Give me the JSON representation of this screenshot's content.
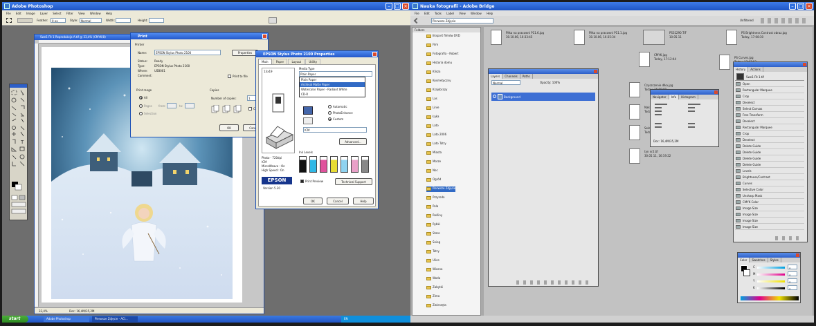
{
  "left": {
    "title": "Adobe Photoshop",
    "menus": [
      "File",
      "Edit",
      "Image",
      "Layer",
      "Select",
      "Filter",
      "View",
      "Window",
      "Help"
    ],
    "options": {
      "feather_label": "Feather:",
      "feather_value": "0 px",
      "style_label": "Style:",
      "style_value": "Normal",
      "width_label": "Width:",
      "height_label": "Height:"
    },
    "doc": {
      "title": "Swe1 Fit 1 Reprodukcja A.tif @ 33,4% (CMYK/8)",
      "zoom": "33,4%",
      "status": "Doc: 16,4M/35,2M"
    },
    "print": {
      "title": "Print",
      "printer_group": "Printer",
      "name_label": "Name:",
      "name_value": "EPSON Stylus Photo 2100",
      "properties_btn": "Properties",
      "status_label": "Status:",
      "status_value": "Ready",
      "type_label": "Type:",
      "type_value": "EPSON Stylus Photo 2100",
      "where_label": "Where:",
      "where_value": "USB001",
      "comment_label": "Comment:",
      "print_to_file": "Print to file",
      "range_group": "Print range",
      "all_label": "All",
      "pages_label": "Pages",
      "from_label": "from:",
      "to_label": "to:",
      "selection_label": "Selection",
      "copies_group": "Copies",
      "num_copies_label": "Number of copies:",
      "num_copies_value": "1",
      "collate_label": "Collate",
      "ok": "OK",
      "cancel": "Cancel"
    },
    "epson": {
      "title": "EPSON Stylus Photo 2100 Properties",
      "tabs": [
        "Main",
        "Paper",
        "Layout",
        "Utility"
      ],
      "paper_size": "13x19",
      "media_type_label": "Media Type",
      "media_value": "Plain Paper",
      "media_options": [
        "Plain Paper",
        "Archival Matte Paper",
        "Watercolor Paper - Radiant White",
        "CD-R"
      ],
      "mode_options": [
        "Automatic",
        "PhotoEnhance",
        "Custom"
      ],
      "mode_selected": "Custom",
      "icm": "ICM",
      "advanced": "Advanced...",
      "info": [
        "Photo - 720dpi",
        "ICM",
        "MicroWeave : On",
        "High Speed : On"
      ],
      "ink_levels": "Ink Levels",
      "ink_colors": [
        "#111111",
        "#2fb8e6",
        "#e0529c",
        "#e8dc33",
        "#8fd3f0",
        "#e9a0c8",
        "#888888"
      ],
      "logo": "EPSON",
      "version": "Version 5.30",
      "print_preview": "Print Preview",
      "tech_support": "Technical Support",
      "ok": "OK",
      "cancel": "Cancel",
      "help": "Help"
    },
    "taskbar": {
      "start": "start",
      "items": [
        "Adobe Photoshop",
        "Pierwsze Zdjęcie - ACI...",
        "EN"
      ]
    }
  },
  "right": {
    "title": "Nauka fotografii - Adobe Bridge",
    "menus": [
      "File",
      "Edit",
      "Tools",
      "Label",
      "View",
      "Window",
      "Help"
    ],
    "path": "Pierwsze Zdjęcie",
    "unfiltered": "Unfiltered",
    "folders_tab": "Folders",
    "folders": [
      "Eksport filmów DVD",
      "Film",
      "Fotografia - Robert",
      "Historia domu",
      "Klisza",
      "Kosmetyczny",
      "Krajobrazy",
      "Las",
      "Linie",
      "Łąka",
      "Lato",
      "Lato 2006",
      "Lato Tatry",
      "Miasta",
      "Morze",
      "Noc",
      "Ogród",
      "Pierwsze Zdjęcie",
      "Przyroda",
      "Pola",
      "Rośliny",
      "Rybki",
      "Stare",
      "Śnieg",
      "Tatry",
      "Ulice",
      "Wiosna",
      "Woda",
      "Zabytki",
      "Zima",
      "Zwierzęta"
    ],
    "thumbs": [
      {
        "name": "Piłka na pracowni P11.6.jpg",
        "date": "30.10.06, 16:33:45"
      },
      {
        "name": "Piłka na pracowni P11.1.jpg",
        "date": "30.10.06, 16:35:34"
      },
      {
        "name": "PS31290.TIF",
        "date": "10.05.11"
      },
      {
        "name": "PS Brightness Contrast obraz.jpg",
        "date": "Today, 17:08:30"
      },
      {
        "name": "CMYK.jpg",
        "date": "Today, 17:12:44"
      },
      {
        "name": "PS Curves.jpg",
        "date": "Today, 17:07:53"
      },
      {
        "name": "Czyszczenie dłka.jpg",
        "date": "Today, 16:09:00"
      },
      {
        "name": "Nakładanie fotografia.jpg",
        "date": "Today, 16:46:55"
      },
      {
        "name": "Selective colors.jpg",
        "date": "Today, 17:06:10"
      },
      {
        "name": "tyn nr2.tif",
        "date": "30.05.11, 16:19:22"
      }
    ],
    "layers": {
      "tabs": [
        "Layers",
        "Channels",
        "Paths"
      ],
      "layer": "Background",
      "normal": "Normal",
      "opacity": "Opacity: 100%"
    },
    "info": {
      "tabs": [
        "Navigator",
        "Info",
        "Histogram"
      ],
      "doc": "Doc: 16,4M/35,2M"
    },
    "history": {
      "tabs": [
        "History",
        "Actions"
      ],
      "snapshot": "Swe1 Fit 1.tif",
      "items": [
        "Open",
        "Rectangular Marquee",
        "Crop",
        "Deselect",
        "Select Canvas",
        "Free Transform",
        "Deselect",
        "Rectangular Marquee",
        "Crop",
        "Deselect",
        "Delete Guide",
        "Delete Guide",
        "Delete Guide",
        "Delete Guide",
        "Levels",
        "Brightness/Contrast",
        "Curves",
        "Selective Color",
        "Unsharp Mask",
        "CMYK Color",
        "Image Size",
        "Image Size",
        "Image Size",
        "Image Size"
      ]
    },
    "color": {
      "tabs": [
        "Color",
        "Swatches",
        "Styles"
      ],
      "c": "C",
      "m": "M",
      "y": "Y",
      "k": "K",
      "value": "0"
    }
  }
}
